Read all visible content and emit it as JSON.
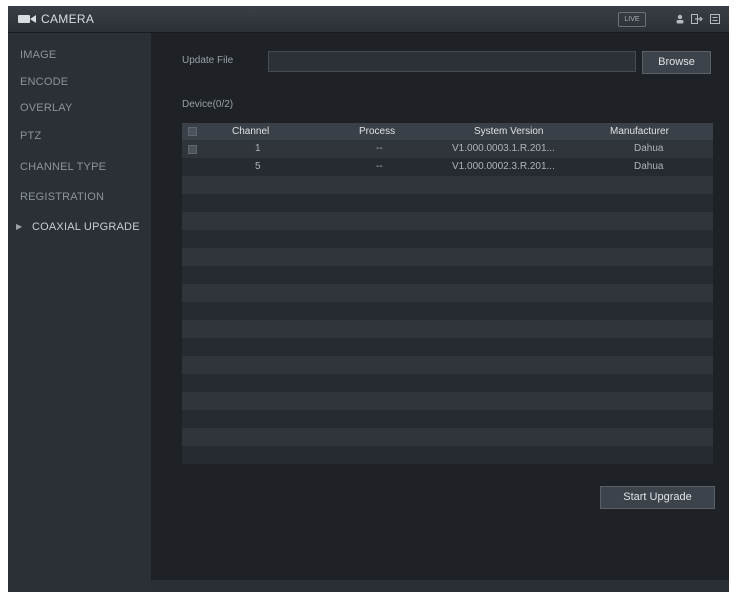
{
  "titlebar": {
    "title": "CAMERA",
    "live_label": "LIVE",
    "icons": [
      "camera-icon",
      "user-icon",
      "logout-icon",
      "menu-icon"
    ]
  },
  "sidebar": {
    "items": [
      {
        "label": "IMAGE",
        "active": false
      },
      {
        "label": "ENCODE",
        "active": false
      },
      {
        "label": "OVERLAY",
        "active": false
      },
      {
        "label": "PTZ",
        "active": false
      },
      {
        "label": "CHANNEL TYPE",
        "active": false
      },
      {
        "label": "REGISTRATION",
        "active": false
      },
      {
        "label": "COAXIAL UPGRADE",
        "active": true
      }
    ]
  },
  "main": {
    "update_file_label": "Update File",
    "update_file_value": "",
    "browse_label": "Browse",
    "device_label": "Device(0/2)",
    "table": {
      "headers": [
        "Channel",
        "Process",
        "System Version",
        "Manufacturer"
      ],
      "rows": [
        [
          "1",
          "--",
          "V1.000.0003.1.R.201...",
          "Dahua"
        ],
        [
          "5",
          "--",
          "V1.000.0002.3.R.201...",
          "Dahua"
        ]
      ],
      "empty_rows": 16
    },
    "start_upgrade_label": "Start Upgrade"
  },
  "colors": {
    "background": "#23272d",
    "sidebar": "#2b3036",
    "content": "#1e2227",
    "header_row": "#3a4047",
    "row_even": "#262b31",
    "row_odd": "#2f353b",
    "text_primary": "#dfe2e6",
    "text_secondary": "#9aa0a7"
  }
}
